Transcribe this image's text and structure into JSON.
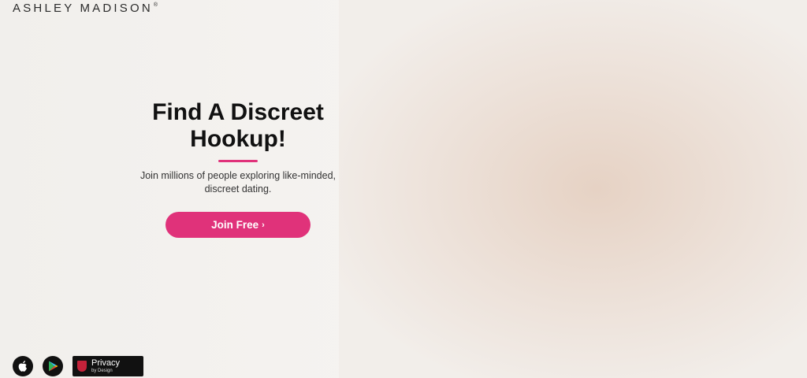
{
  "brand": {
    "name": "ASHLEY MADISON",
    "registered_mark": "®"
  },
  "hero": {
    "headline_line1": "Find A Discreet",
    "headline_line2": "Hookup!",
    "subtitle": "Join millions of people exploring like-minded, discreet dating.",
    "cta_label": "Join Free",
    "cta_chevron": "›"
  },
  "colors": {
    "accent": "#e0327a",
    "text": "#111111"
  },
  "badges": {
    "apple_icon": "apple-icon",
    "google_play_icon": "google-play-icon",
    "privacy_title": "Privacy",
    "privacy_subtitle": "by Design"
  }
}
